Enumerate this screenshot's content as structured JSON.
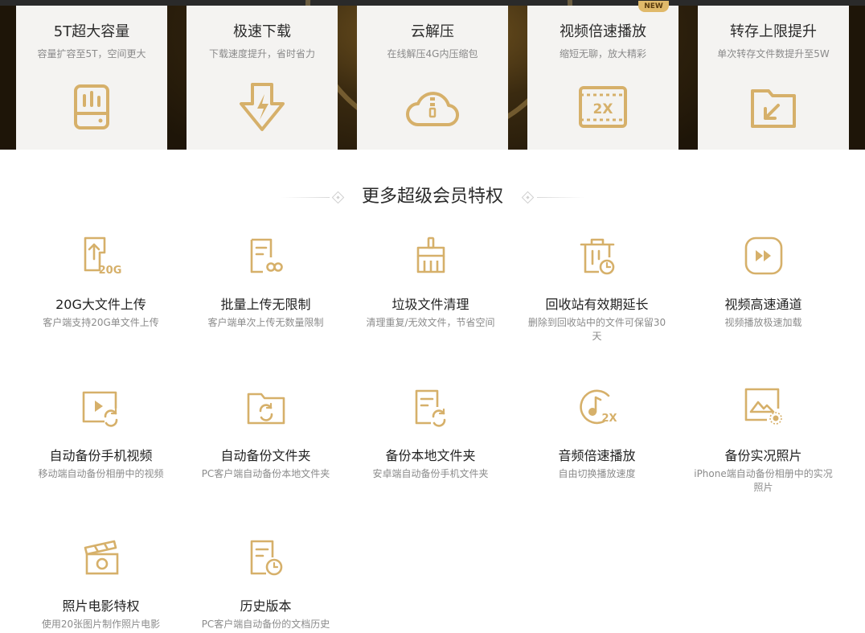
{
  "banner": {
    "cards": [
      {
        "title": "5T超大容量",
        "sub": "容量扩容至5T，空间更大",
        "icon": "storage-icon"
      },
      {
        "title": "极速下载",
        "sub": "下载速度提升，省时省力",
        "icon": "fast-download-icon"
      },
      {
        "title": "云解压",
        "sub": "在线解压4G内压缩包",
        "icon": "cloud-unzip-icon"
      },
      {
        "title": "视频倍速播放",
        "sub": "缩短无聊，放大精彩",
        "icon": "video-2x-icon",
        "badge": "NEW"
      },
      {
        "title": "转存上限提升",
        "sub": "单次转存文件数提升至5W",
        "icon": "transfer-folder-icon"
      }
    ]
  },
  "section": {
    "title": "更多超级会员特权"
  },
  "accent_color": "#d6b06a",
  "features": [
    {
      "title": "20G大文件上传",
      "sub": "客户端支持20G单文件上传",
      "icon": "upload-20g-icon"
    },
    {
      "title": "批量上传无限制",
      "sub": "客户端单次上传无数量限制",
      "icon": "unlimited-upload-icon"
    },
    {
      "title": "垃圾文件清理",
      "sub": "清理重复/无效文件，节省空间",
      "icon": "broom-icon"
    },
    {
      "title": "回收站有效期延长",
      "sub": "删除到回收站中的文件可保留30天",
      "icon": "recycle-bin-clock-icon"
    },
    {
      "title": "视频高速通道",
      "sub": "视频播放极速加载",
      "icon": "fast-forward-icon"
    },
    {
      "title": "自动备份手机视频",
      "sub": "移动端自动备份相册中的视频",
      "icon": "video-backup-icon"
    },
    {
      "title": "自动备份文件夹",
      "sub": "PC客户端自动备份本地文件夹",
      "icon": "folder-sync-icon"
    },
    {
      "title": "备份本地文件夹",
      "sub": "安卓端自动备份手机文件夹",
      "icon": "document-sync-icon"
    },
    {
      "title": "音频倍速播放",
      "sub": "自由切换播放速度",
      "icon": "audio-2x-icon"
    },
    {
      "title": "备份实况照片",
      "sub": "iPhone端自动备份相册中的实况照片",
      "icon": "live-photo-icon"
    },
    {
      "title": "照片电影特权",
      "sub": "使用20张图片制作照片电影",
      "icon": "clapper-icon"
    },
    {
      "title": "历史版本",
      "sub": "PC客户端自动备份的文档历史",
      "icon": "history-version-icon"
    }
  ]
}
